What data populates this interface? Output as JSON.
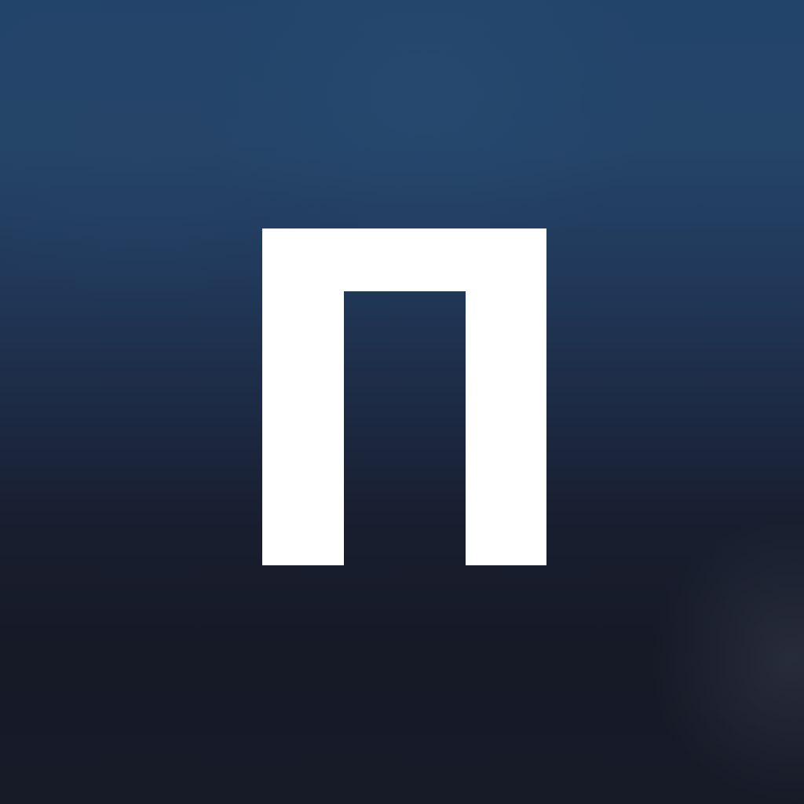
{
  "app_icon": {
    "glyph_name": "pi-glyph-icon",
    "colors": {
      "glyph": "#ffffff",
      "background_top": "#23446a",
      "background_bottom": "#171b28"
    }
  }
}
